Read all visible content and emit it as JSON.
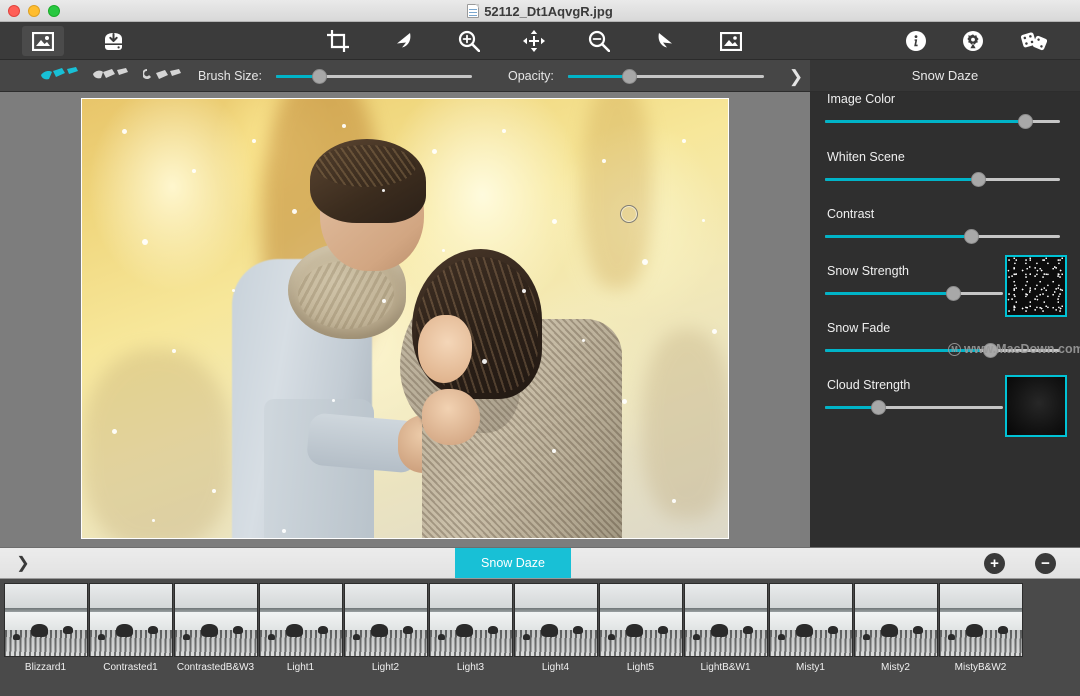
{
  "window": {
    "title": "52112_Dt1AqvgR.jpg",
    "traffic_lights": [
      "close",
      "minimize",
      "zoom"
    ]
  },
  "toolbar": {
    "items": [
      {
        "name": "open-image-icon",
        "label": "Open Image",
        "active": true
      },
      {
        "name": "save-image-icon",
        "label": "Save Image",
        "active": false
      },
      {
        "name": "crop-icon",
        "label": "Crop",
        "active": false
      },
      {
        "name": "undo-icon",
        "label": "Undo",
        "active": false
      },
      {
        "name": "zoom-in-icon",
        "label": "Zoom In",
        "active": false
      },
      {
        "name": "pan-move-icon",
        "label": "Pan",
        "active": false
      },
      {
        "name": "zoom-out-icon",
        "label": "Zoom Out",
        "active": false
      },
      {
        "name": "redo-icon",
        "label": "Redo",
        "active": false
      },
      {
        "name": "fit-image-icon",
        "label": "Fit Image",
        "active": false
      },
      {
        "name": "info-icon",
        "label": "Info",
        "active": false
      },
      {
        "name": "settings-icon",
        "label": "Settings",
        "active": false
      },
      {
        "name": "random-dice-icon",
        "label": "Random",
        "active": false
      }
    ]
  },
  "brushbar": {
    "brushes": [
      {
        "name": "brush-paint",
        "active": true
      },
      {
        "name": "brush-erase",
        "active": false
      },
      {
        "name": "brush-reset",
        "active": false
      }
    ],
    "brush_size_label": "Brush Size:",
    "brush_size_value": 22,
    "opacity_label": "Opacity:",
    "opacity_value": 40,
    "expand_icon": "chevron-right",
    "preset_name": "Snow Daze"
  },
  "panel": {
    "sliders": [
      {
        "label": "Image Color",
        "value": 85
      },
      {
        "label": "Whiten Scene",
        "value": 65
      },
      {
        "label": "Contrast",
        "value": 62
      },
      {
        "label": "Snow Strength",
        "value": 72,
        "swatch": "snow-noise"
      },
      {
        "label": "Snow Fade",
        "value": 95
      },
      {
        "label": "Cloud Strength",
        "value": 30,
        "swatch": "cloud"
      }
    ],
    "watermark": "www.MacDown.com"
  },
  "bottombar": {
    "collapse_icon": "chevron-down",
    "active_preset": "Snow Daze",
    "add_label": "+",
    "remove_label": "−"
  },
  "presets": [
    {
      "label": "Blizzard1"
    },
    {
      "label": "Contrasted1"
    },
    {
      "label": "ContrastedB&W3"
    },
    {
      "label": "Light1"
    },
    {
      "label": "Light2"
    },
    {
      "label": "Light3"
    },
    {
      "label": "Light4"
    },
    {
      "label": "Light5"
    },
    {
      "label": "LightB&W1"
    },
    {
      "label": "Misty1"
    },
    {
      "label": "Misty2"
    },
    {
      "label": "MistyB&W2"
    }
  ],
  "colors": {
    "accent": "#00b4c8",
    "accent_button": "#18c0d6",
    "toolbar_bg": "#3b3b3b",
    "panel_bg": "#2f2f2f",
    "canvas_bg": "#7d7d7d",
    "strip_bg": "#4a4a4a"
  }
}
